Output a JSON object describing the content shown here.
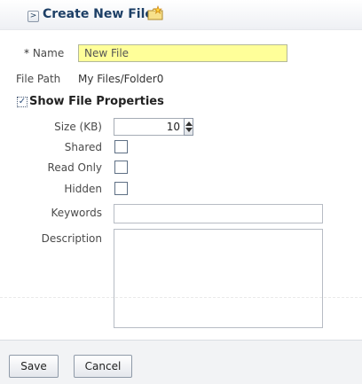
{
  "header": {
    "toggle_glyph": ">",
    "title": "Create New File",
    "icon": "new-file-icon"
  },
  "form": {
    "name": {
      "required_mark": "* ",
      "label": "Name",
      "value": "New File"
    },
    "file_path": {
      "label": "File Path",
      "value": "My Files/Folder0"
    },
    "properties_section": {
      "checked_glyph": "✓",
      "title": "Show File Properties"
    },
    "size": {
      "label": "Size (KB)",
      "value": "10"
    },
    "shared": {
      "label": "Shared",
      "checked": false
    },
    "read_only": {
      "label": "Read Only",
      "checked": false
    },
    "hidden": {
      "label": "Hidden",
      "checked": false
    },
    "keywords": {
      "label": "Keywords",
      "value": ""
    },
    "description": {
      "label": "Description",
      "value": ""
    }
  },
  "footer": {
    "save_label": "Save",
    "cancel_label": "Cancel"
  },
  "colors": {
    "header_title": "#1d3f66",
    "name_field_bg": "#ffff99",
    "footer_bg": "#f2f3f5"
  }
}
